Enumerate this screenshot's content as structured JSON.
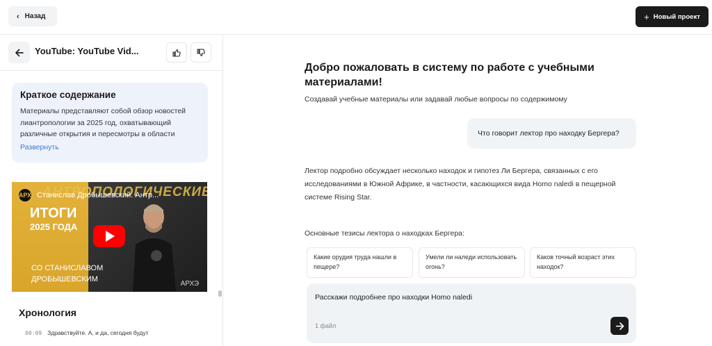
{
  "topbar": {
    "back_label": "Назад",
    "new_project_label": "Новый проект"
  },
  "left": {
    "title": "YouTube: YouTube Vid...",
    "summary": {
      "heading": "Краткое содержание",
      "text": "Материалы представляют собой обзор новостей лиантропологии за 2025 год, охватывающий различные открытия и пересмотры в области",
      "expand": "Развернуть"
    },
    "video": {
      "overlay_title": "Станислав Дробышевский. Антр...",
      "big_title": "АНТРОПОЛОГИЧЕСКИЕ",
      "itogi": "ИТОГИ",
      "year": "2025 ГОДА",
      "sub1": "СО СТАНИСЛАВОМ",
      "sub2": "ДРОБЫШЕВСКИМ",
      "logo": "АРХ",
      "watermark": "АРХЭ"
    },
    "chronology": {
      "heading": "Хронология",
      "items": [
        {
          "time": "00:09",
          "text": "Здравствуйте. А, и да, сегодня будут"
        }
      ]
    }
  },
  "main": {
    "welcome_title": "Добро пожаловать в систему по работе с учебными материалами!",
    "welcome_sub": "Создавай учебные материалы или задавай любые вопросы по содержимому",
    "user_message": "Что говорит лектор про находку Бергера?",
    "answer": "Лектор подробно обсуждает несколько находок и гипотез Ли Бергера, связанных с его исследованиями в Южной Африке, в частности, касающихся вида Homo naledi в пещерной системе Rising Star.",
    "theses_label": "Основные тезисы лектора о находках Бергера:",
    "suggestions": [
      "Какие орудия труда нашли в пещере?",
      "Умели ли наледи использовать огонь?",
      "Каков точный возраст этих находок?"
    ],
    "composer": {
      "text": "Расскажи подробнее про находки Homo naledi",
      "files": "1 файл"
    }
  }
}
